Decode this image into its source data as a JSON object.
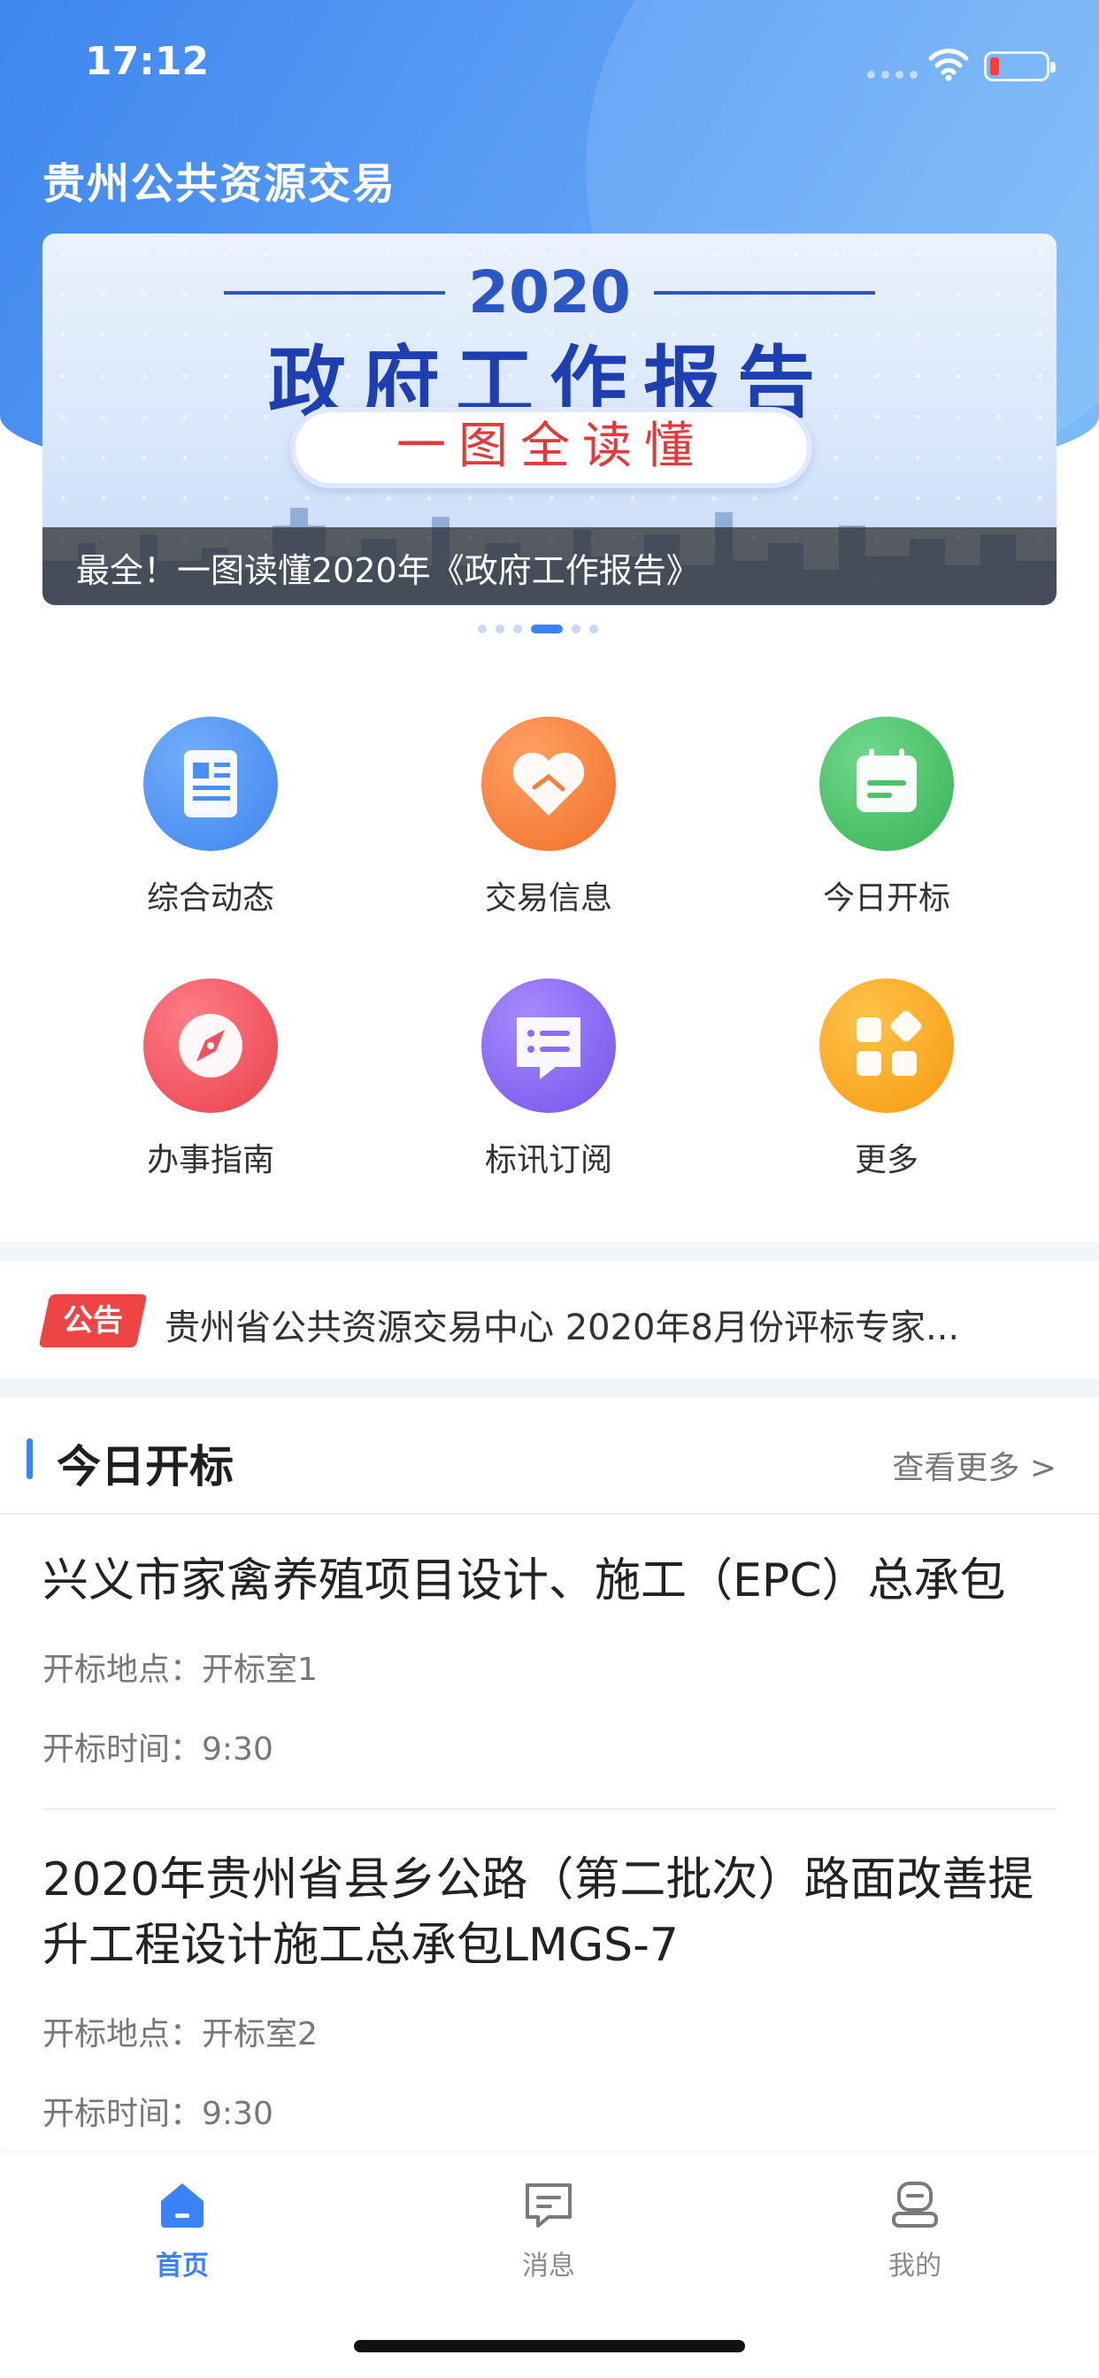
{
  "status_bar": {
    "time": "17:12"
  },
  "app_title": "贵州公共资源交易",
  "banner": {
    "year": "2020",
    "heading": "政府工作报告",
    "subheading": "一图全读懂",
    "caption": "最全！一图读懂2020年《政府工作报告》",
    "page_count": 6,
    "active_page": 4
  },
  "grid": [
    {
      "label": "综合动态",
      "icon": "news-icon",
      "color": "#4a8ff5"
    },
    {
      "label": "交易信息",
      "icon": "handshake-heart-icon",
      "color": "#f5803a"
    },
    {
      "label": "今日开标",
      "icon": "calendar-icon",
      "color": "#4cc26a"
    },
    {
      "label": "办事指南",
      "icon": "compass-icon",
      "color": "#f0535f"
    },
    {
      "label": "标讯订阅",
      "icon": "message-list-icon",
      "color": "#8b6cf2"
    },
    {
      "label": "更多",
      "icon": "apps-grid-icon",
      "color": "#f7a41c"
    }
  ],
  "notice": {
    "tag": "公告",
    "text": "贵州省公共资源交易中心 2020年8月份评标专家..."
  },
  "section": {
    "title": "今日开标",
    "more": "查看更多 >"
  },
  "bids": [
    {
      "title": "兴义市家禽养殖项目设计、施工（EPC）总承包",
      "location": "开标地点：开标室1",
      "time": "开标时间：9:30"
    },
    {
      "title": "2020年贵州省县乡公路（第二批次）路面改善提升工程设计施工总承包LMGS-7",
      "location": "开标地点：开标室2",
      "time": "开标时间：9:30"
    }
  ],
  "tabbar": [
    {
      "label": "首页",
      "icon": "home-icon",
      "active": true
    },
    {
      "label": "消息",
      "icon": "message-icon",
      "active": false
    },
    {
      "label": "我的",
      "icon": "profile-icon",
      "active": false
    }
  ],
  "colors": {
    "accent": "#3b82f6",
    "notice_tag": "#ef4444"
  }
}
